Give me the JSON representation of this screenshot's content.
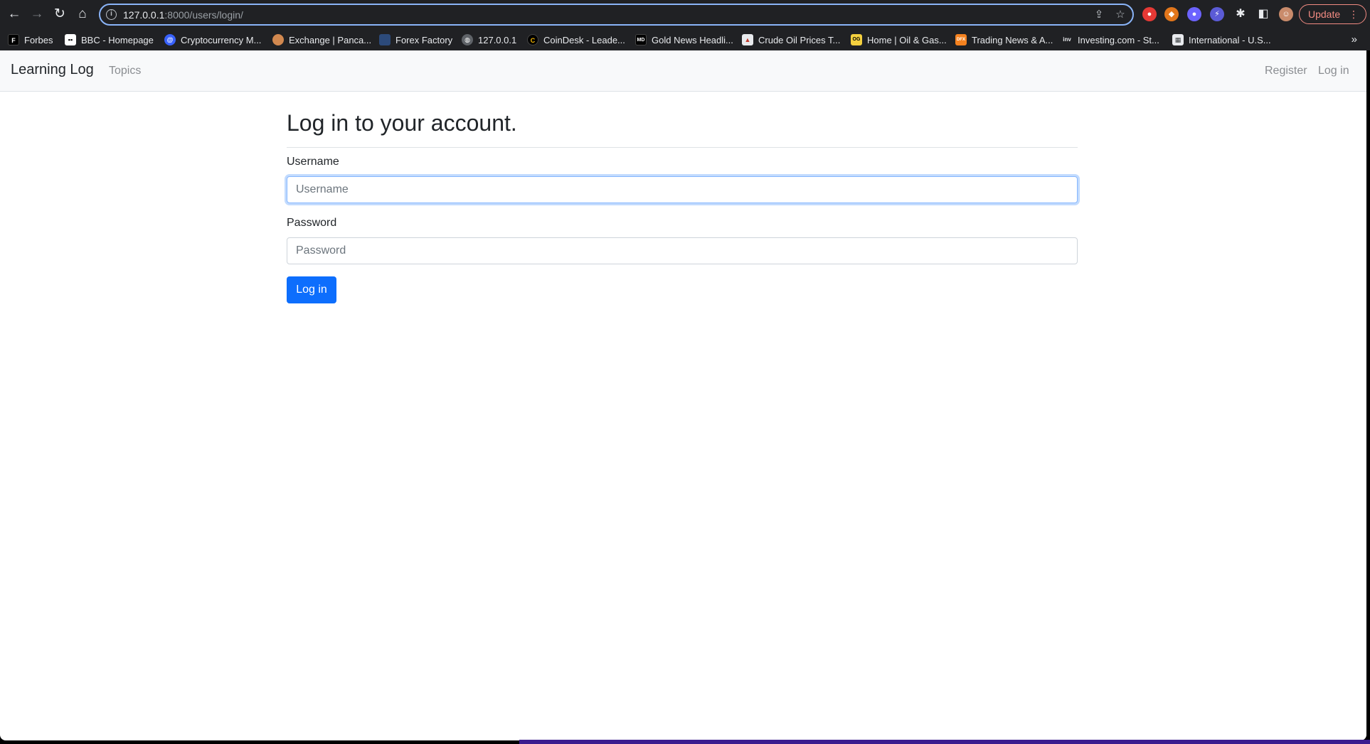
{
  "browser": {
    "url_host": "127.0.0.1",
    "url_path": ":8000/users/login/",
    "update_label": "Update",
    "more_bookmarks": "»",
    "bookmarks": [
      {
        "label": "Forbes",
        "icon": "forbes-icon",
        "color": "#000000",
        "glyph": "F"
      },
      {
        "label": "BBC - Homepage",
        "icon": "bbc-icon",
        "color": "#ffffff",
        "glyph": "▪▪"
      },
      {
        "label": "Cryptocurrency M...",
        "icon": "crypto-icon",
        "color": "#3861fb",
        "glyph": "@"
      },
      {
        "label": "Exchange | Panca...",
        "icon": "pancake-icon",
        "color": "#d1884f",
        "glyph": "●"
      },
      {
        "label": "Forex Factory",
        "icon": "forex-factory-icon",
        "color": "#2c4a7a",
        "glyph": "▰"
      },
      {
        "label": "127.0.0.1",
        "icon": "globe-icon",
        "color": "#5f6368",
        "glyph": "◍"
      },
      {
        "label": "CoinDesk - Leade...",
        "icon": "coindesk-icon",
        "color": "#000000",
        "glyph": "C"
      },
      {
        "label": "Gold News Headli...",
        "icon": "gold-news-icon",
        "color": "#000000",
        "glyph": "MD"
      },
      {
        "label": "Crude Oil Prices T...",
        "icon": "crude-oil-icon",
        "color": "#e8eaed",
        "glyph": "▲"
      },
      {
        "label": "Home | Oil & Gas...",
        "icon": "oil-gas-icon",
        "color": "#f4d03f",
        "glyph": "OG"
      },
      {
        "label": "Trading News & A...",
        "icon": "trading-news-icon",
        "color": "#f5821f",
        "glyph": "DFX"
      },
      {
        "label": "Investing.com - St...",
        "icon": "investing-icon",
        "color": "#202124",
        "glyph": "inv"
      },
      {
        "label": "International - U.S...",
        "icon": "international-icon",
        "color": "#e8eaed",
        "glyph": "▦"
      }
    ],
    "extensions": [
      {
        "name": "red-extension-icon",
        "color": "#e53935"
      },
      {
        "name": "metamask-icon",
        "color": "#e2761b"
      },
      {
        "name": "purple-extension-icon",
        "color": "#6c63ff"
      },
      {
        "name": "bolt-extension-icon",
        "color": "#5b5bd6"
      }
    ]
  },
  "navbar": {
    "brand": "Learning Log",
    "topics": "Topics",
    "register": "Register",
    "login": "Log in"
  },
  "form": {
    "title": "Log in to your account.",
    "username_label": "Username",
    "username_placeholder": "Username",
    "password_label": "Password",
    "password_placeholder": "Password",
    "submit": "Log in"
  },
  "colors": {
    "primary": "#0d6efd",
    "navbar_bg": "#f8f9fa",
    "chrome_bg": "#202124"
  }
}
